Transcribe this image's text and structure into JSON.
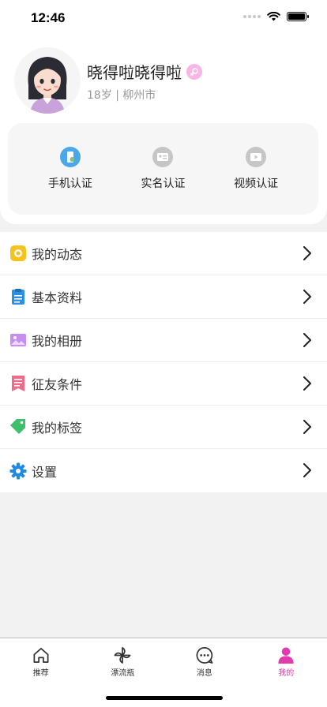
{
  "status_bar": {
    "time": "12:46"
  },
  "profile": {
    "name": "晓得啦晓得啦",
    "meta": "18岁 | 柳州市"
  },
  "verification": [
    {
      "label": "手机认证",
      "icon": "phone-verify-icon",
      "color": "#4aa8e8"
    },
    {
      "label": "实名认证",
      "icon": "id-card-icon",
      "color": "#c6c6c6"
    },
    {
      "label": "视频认证",
      "icon": "video-verify-icon",
      "color": "#c6c6c6"
    }
  ],
  "menu": [
    {
      "label": "我的动态",
      "icon": "moments-icon",
      "color": "#f7c21c"
    },
    {
      "label": "基本资料",
      "icon": "clipboard-icon",
      "color": "#2f8fe0"
    },
    {
      "label": "我的相册",
      "icon": "album-icon",
      "color": "#c68ef0"
    },
    {
      "label": "征友条件",
      "icon": "list-bookmark-icon",
      "color": "#f06a8a"
    },
    {
      "label": "我的标签",
      "icon": "tag-icon",
      "color": "#3cc06a"
    },
    {
      "label": "设置",
      "icon": "gear-icon",
      "color": "#1e8ae6"
    }
  ],
  "tabs": [
    {
      "label": "推荐",
      "icon": "home-icon"
    },
    {
      "label": "漂流瓶",
      "icon": "pinwheel-icon"
    },
    {
      "label": "消息",
      "icon": "chat-icon"
    },
    {
      "label": "我的",
      "icon": "user-icon",
      "active": true
    }
  ],
  "colors": {
    "accent": "#e23bb0",
    "badge": "#f7b6e6"
  }
}
